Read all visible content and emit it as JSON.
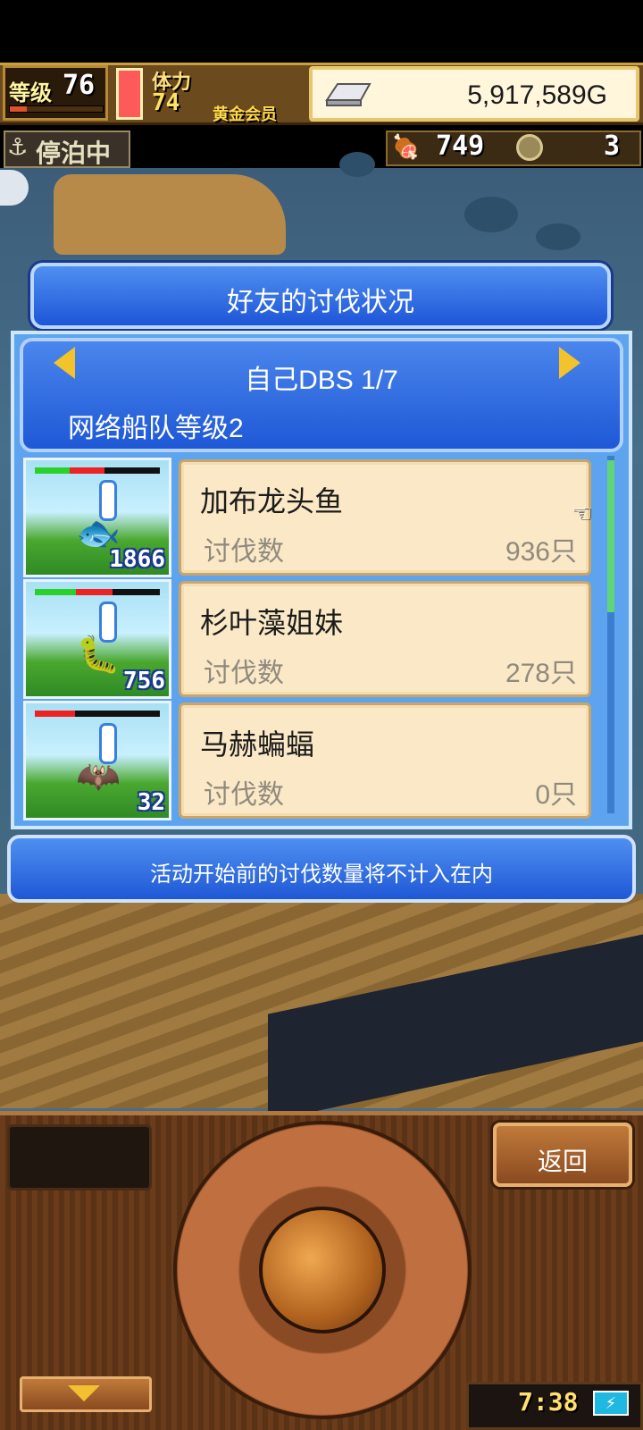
{
  "hud": {
    "level_label": "等级",
    "level_value": "76",
    "level_progress": 0.18,
    "stamina_label": "体力",
    "stamina_value": "74",
    "member_label": "黄金会员",
    "gold": "5,917,589G"
  },
  "status_row": {
    "dock_status": "停泊中",
    "food_value": "749",
    "coin_value": "3"
  },
  "modal": {
    "title": "好友的讨伐状况",
    "page_indicator": "自己DBS 1/7",
    "fleet_level": "网络船队等级2",
    "kill_label": "讨伐数",
    "notice": "活动开始前的讨伐数量将不计入在内"
  },
  "monsters": [
    {
      "name": "加布龙头鱼",
      "kills": "936只",
      "count": "1866",
      "hp_green": 0.28,
      "hp_red": 0.28,
      "icon": "fish-monster-icon",
      "glyph": "🐟"
    },
    {
      "name": "杉叶藻姐妹",
      "kills": "278只",
      "count": "756",
      "hp_green": 0.33,
      "hp_red": 0.62,
      "icon": "worm-monster-icon",
      "glyph": "🐛"
    },
    {
      "name": "马赫蝙蝠",
      "kills": "0只",
      "count": "32",
      "hp_green": 0.0,
      "hp_red": 0.32,
      "icon": "bat-monster-icon",
      "glyph": "🦇"
    }
  ],
  "controls": {
    "back_label": "返回",
    "clock": "7:38"
  },
  "colors": {
    "modal_blue": "#1e56d8",
    "card_bg": "#fbe8c6",
    "gold_accent": "#f2c32a",
    "wood": "#6a3c1c"
  }
}
